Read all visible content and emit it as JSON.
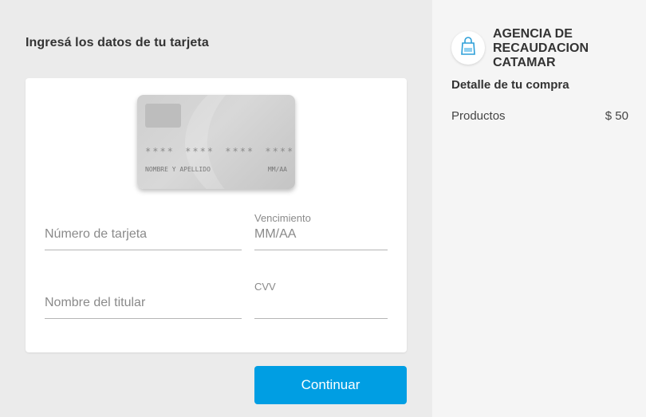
{
  "form": {
    "heading": "Ingresá los datos de tu tarjeta",
    "card_preview": {
      "number": "**** **** **** ****",
      "holder": "NOMBRE Y APELLIDO",
      "expiry": "MM/AA"
    },
    "card_number": {
      "placeholder": "Número de tarjeta",
      "value": ""
    },
    "expiry": {
      "label": "Vencimiento",
      "placeholder": "MM/AA",
      "value": ""
    },
    "holder_name": {
      "placeholder": "Nombre del titular",
      "value": ""
    },
    "cvv": {
      "label": "CVV",
      "placeholder": "",
      "value": ""
    },
    "continue_label": "Continuar"
  },
  "summary": {
    "merchant": "AGENCIA DE RECAUDACION CATAMAR",
    "merchant_icon": "shopping-bag-icon",
    "detail_title": "Detalle de tu compra",
    "items": [
      {
        "label": "Productos",
        "price": "$ 50"
      }
    ]
  },
  "colors": {
    "accent": "#009ee3",
    "left_bg": "#ebebeb",
    "right_bg": "#f5f5f5"
  }
}
